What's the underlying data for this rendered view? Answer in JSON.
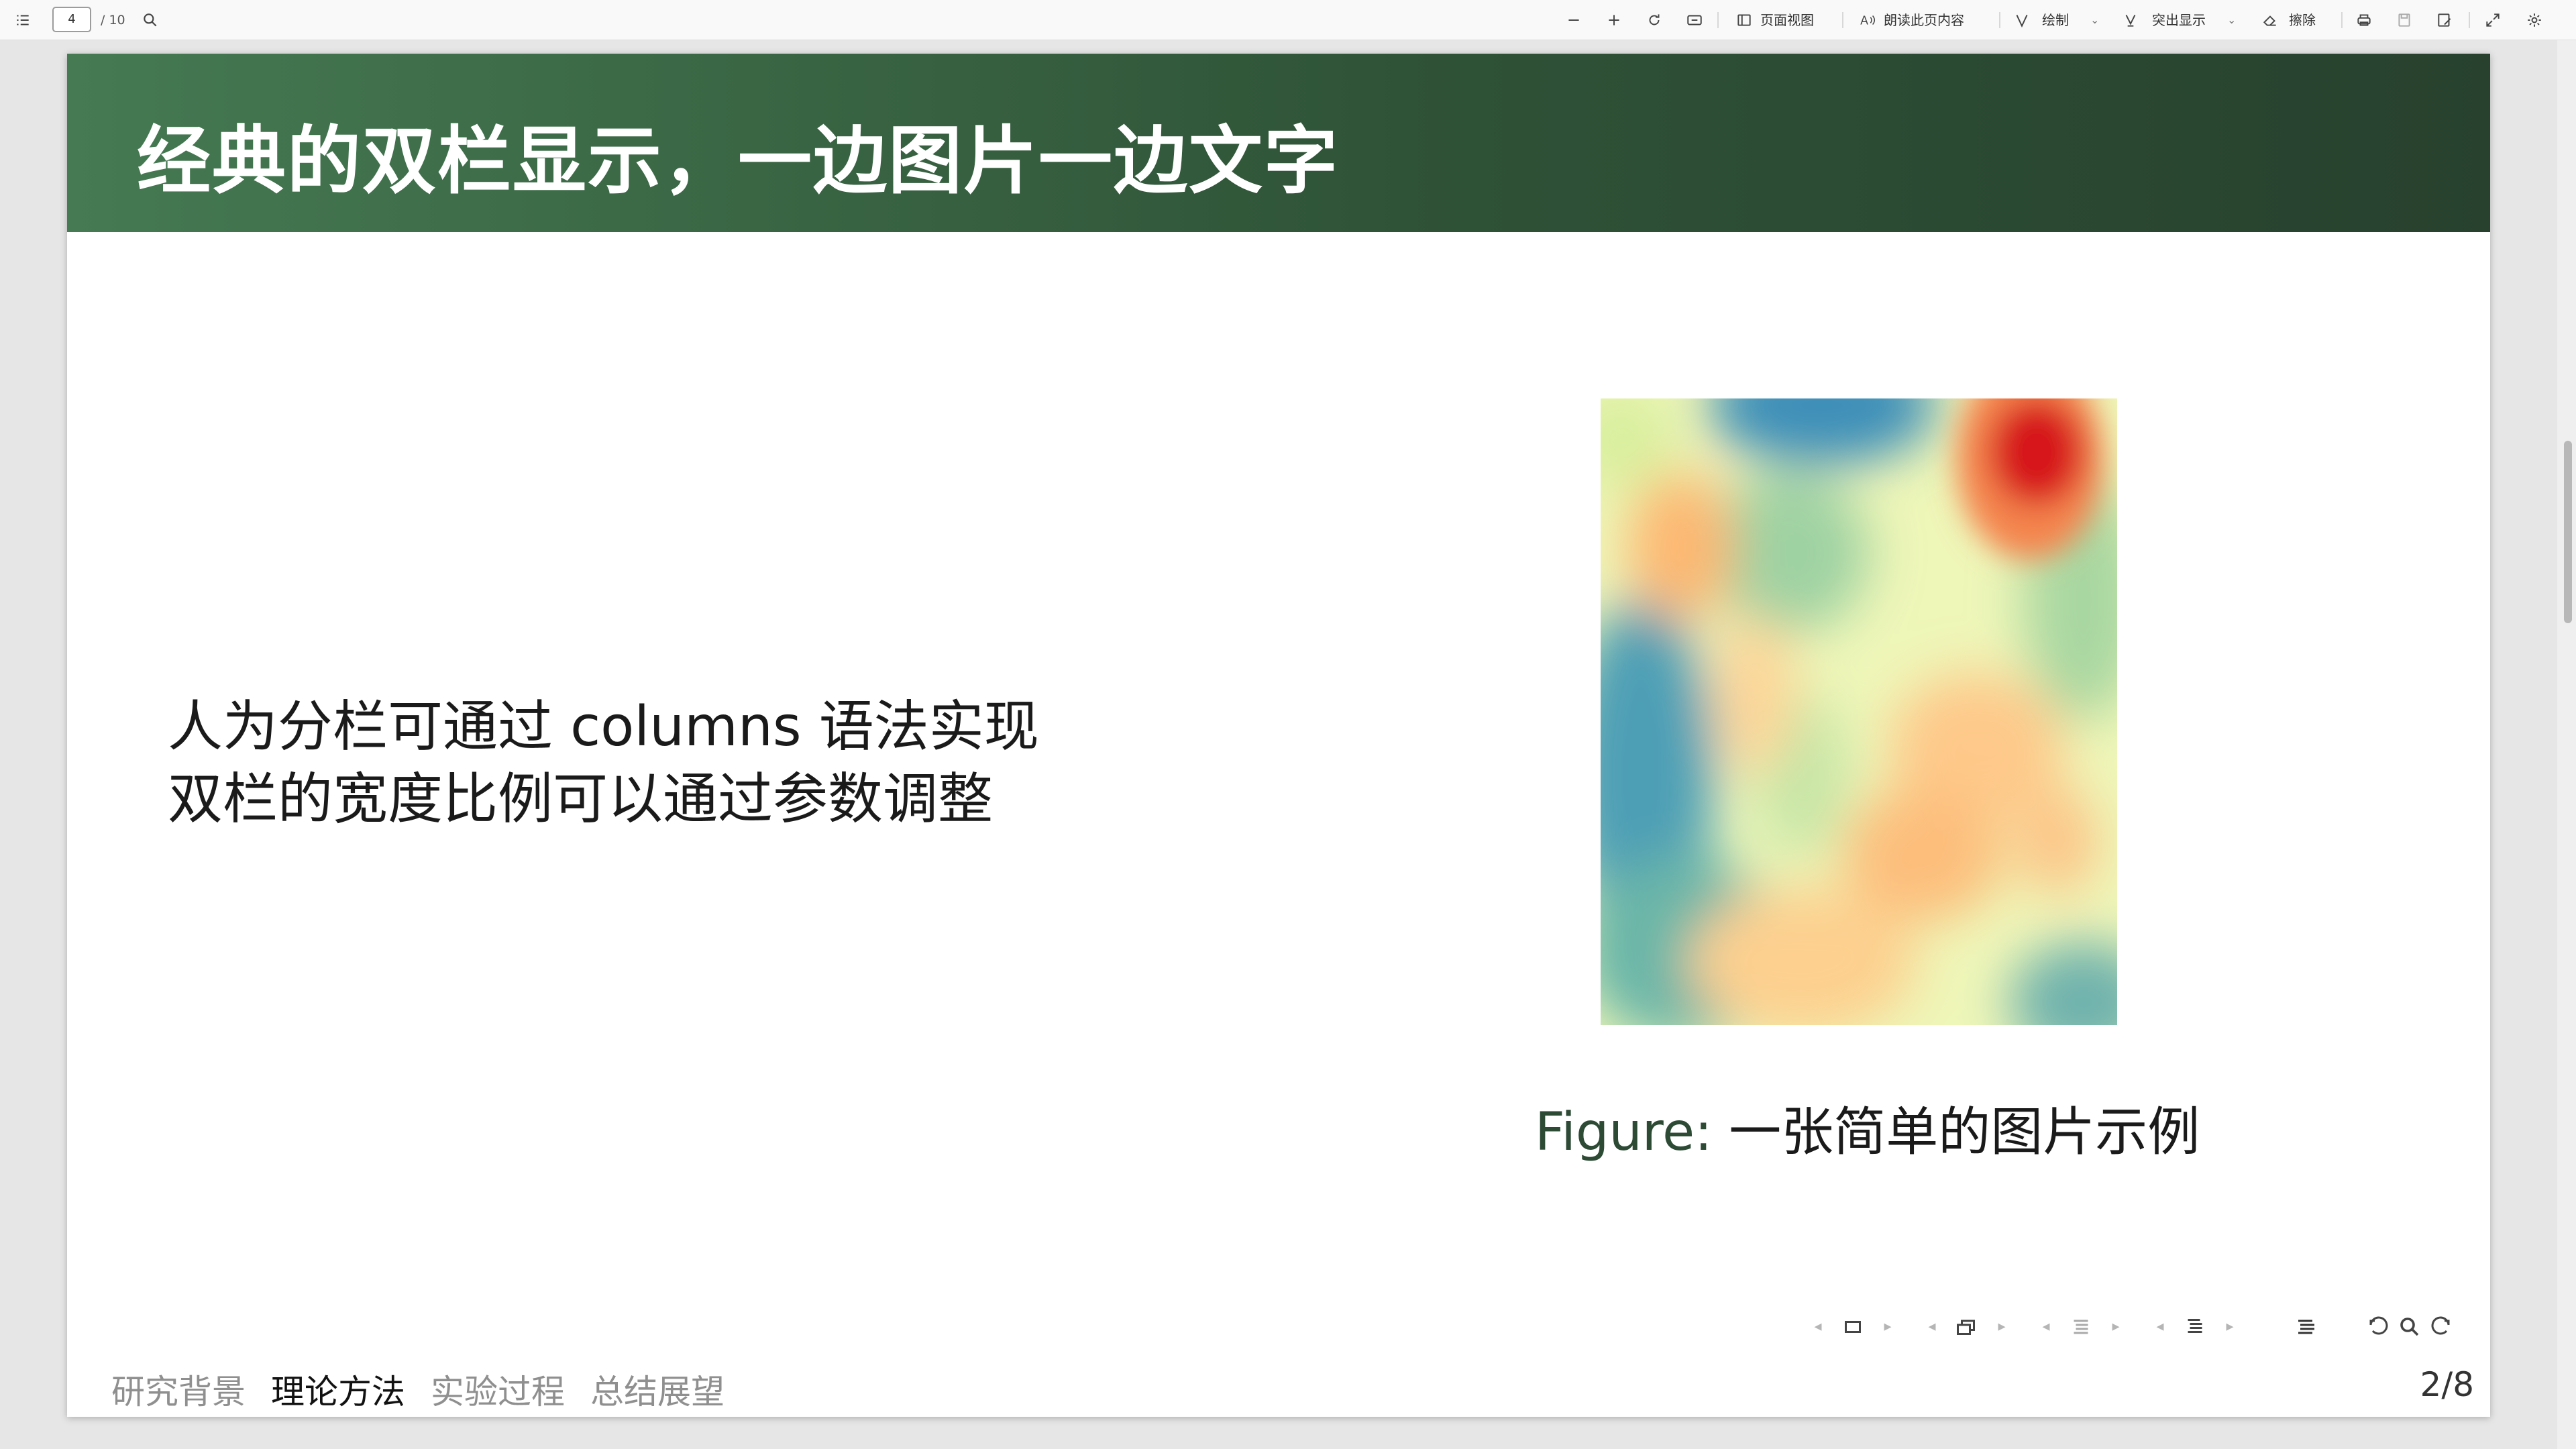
{
  "toolbar": {
    "current_page": "4",
    "total_pages": "/ 10",
    "page_view_label": "页面视图",
    "read_aloud_label": "朗读此页内容",
    "draw_label": "绘制",
    "highlight_label": "突出显示",
    "erase_label": "擦除"
  },
  "slide": {
    "title": "经典的双栏显示，一边图片一边文字",
    "body_lines": [
      "人为分栏可通过 columns 语法实现",
      "双栏的宽度比例可以通过参数调整"
    ],
    "caption_prefix": "Figure:",
    "caption_text": " 一张简单的图片示例",
    "sections": [
      {
        "label": "研究背景",
        "active": false
      },
      {
        "label": "理论方法",
        "active": true
      },
      {
        "label": "实验过程",
        "active": false
      },
      {
        "label": "总结展望",
        "active": false
      }
    ],
    "page_counter": "2/8"
  },
  "colors": {
    "header_start": "#457a52",
    "header_end": "#27412e",
    "heatmap_hot": "#d7191c",
    "heatmap_cold": "#2b83ba"
  }
}
